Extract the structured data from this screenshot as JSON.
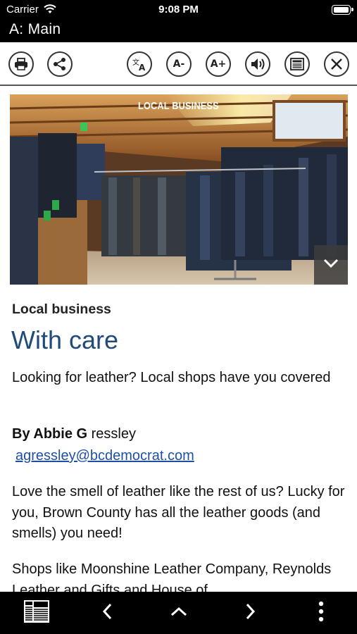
{
  "status_bar": {
    "carrier": "Carrier",
    "time": "9:08 PM",
    "battery_level": 1.0
  },
  "title_bar": {
    "title": "A: Main"
  },
  "toolbar": {
    "items": [
      {
        "name": "print",
        "icon": "printer-icon"
      },
      {
        "name": "share",
        "icon": "share-icon"
      },
      {
        "name": "translate",
        "icon": "translate-icon"
      },
      {
        "name": "font-decrease",
        "label": "A-"
      },
      {
        "name": "font-increase",
        "label": "A+"
      },
      {
        "name": "listen",
        "icon": "speaker-icon"
      },
      {
        "name": "page-view",
        "icon": "newspaper-icon"
      },
      {
        "name": "close",
        "icon": "close-icon"
      }
    ]
  },
  "article": {
    "image_label": "LOCAL BUSINESS",
    "kicker": "Local business",
    "headline": "With care",
    "subhead": "Looking for leather? Local shops have you covered",
    "byline_prefix": "By ",
    "byline_bold": "Abbie G",
    "byline_rest": " ressley",
    "email": "agressley@bcdemocrat.com",
    "paragraphs": [
      "Love the smell of leather like the rest of us? Lucky for you, Brown County has all the leather goods (and smells) you need!",
      "Shops like Moonshine Leather Company, Reynolds Leather and Gifts and House of"
    ]
  },
  "bottom_bar": {
    "icons": [
      "newspaper-pages-icon",
      "chevron-left-icon",
      "chevron-up-icon",
      "chevron-right-icon",
      "more-vertical-icon"
    ]
  }
}
